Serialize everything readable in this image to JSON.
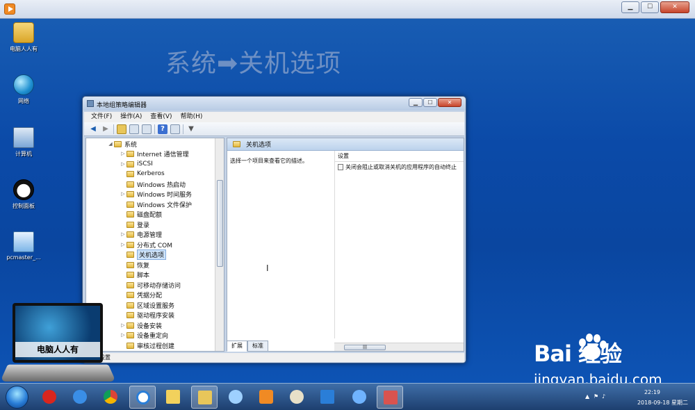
{
  "screen": {
    "background": "#0b4aa8"
  },
  "desktop": {
    "icons": [
      {
        "label": "电脑人人有",
        "icon": "folder-user-icon"
      },
      {
        "label": "网络",
        "icon": "network-globe-icon"
      },
      {
        "label": "计算机",
        "icon": "computer-icon"
      },
      {
        "label": "控制面板",
        "icon": "panda-control-panel-icon"
      },
      {
        "label": "pcmaster_...",
        "icon": "disk-file-icon"
      }
    ],
    "headline": "系统➡关机选项"
  },
  "window": {
    "title": "本地组策略编辑器",
    "menu": [
      "文件(F)",
      "操作(A)",
      "查看(V)",
      "帮助(H)"
    ],
    "toolbar": {
      "buttons": [
        "back-arrow-icon",
        "forward-arrow-icon",
        "up-folder-icon",
        "show-hide-tree-icon",
        "export-list-icon",
        "help-icon",
        "properties-icon",
        "filter-icon"
      ]
    },
    "tree": [
      {
        "label": "系统",
        "level": 0,
        "expanded": true
      },
      {
        "label": "Internet 通信管理",
        "level": 1,
        "expandable": true
      },
      {
        "label": "iSCSI",
        "level": 1,
        "expandable": true
      },
      {
        "label": "Kerberos",
        "level": 1
      },
      {
        "label": "Windows 热启动",
        "level": 1
      },
      {
        "label": "Windows 时间服务",
        "level": 1,
        "expandable": true
      },
      {
        "label": "Windows 文件保护",
        "level": 1
      },
      {
        "label": "磁盘配额",
        "level": 1
      },
      {
        "label": "登录",
        "level": 1
      },
      {
        "label": "电源管理",
        "level": 1,
        "expandable": true
      },
      {
        "label": "分布式 COM",
        "level": 1,
        "expandable": true
      },
      {
        "label": "关机选项",
        "level": 1,
        "selected": true
      },
      {
        "label": "恢复",
        "level": 1
      },
      {
        "label": "脚本",
        "level": 1
      },
      {
        "label": "可移动存储访问",
        "level": 1
      },
      {
        "label": "凭据分配",
        "level": 1
      },
      {
        "label": "区域设置服务",
        "level": 1
      },
      {
        "label": "驱动程序安装",
        "level": 1
      },
      {
        "label": "设备安装",
        "level": 1,
        "expandable": true
      },
      {
        "label": "设备重定向",
        "level": 1,
        "expandable": true
      },
      {
        "label": "审核过程创建",
        "level": 1
      }
    ],
    "right": {
      "header": "关机选项",
      "description": "选择一个项目来查看它的描述。",
      "column": "设置",
      "rows": [
        "关闭会阻止或取消关机的应用程序的自动终止"
      ],
      "scroll_thumb": "|||"
    },
    "tabs": [
      "扩展",
      "标准"
    ],
    "status": "设置"
  },
  "laptop_logo": "电脑人人有",
  "taskbar": {
    "time": "22:19",
    "date": "2018-09-18 星期二",
    "tray": [
      "chevron-up-icon",
      "flag-icon",
      "speaker-icon"
    ]
  },
  "watermark": {
    "brand": "Bai  经验",
    "url": "jingyan.baidu.com"
  }
}
